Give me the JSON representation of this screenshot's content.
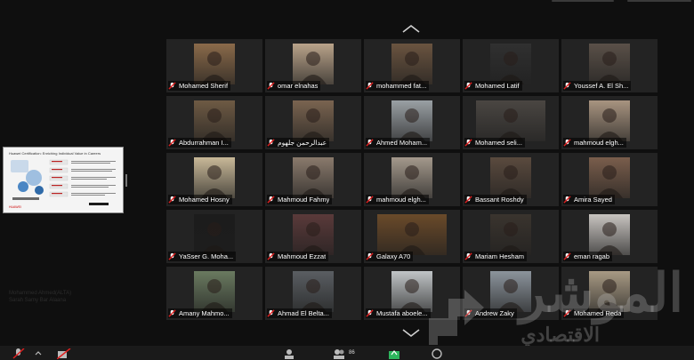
{
  "participants": [
    {
      "name": "Mohamed Sherif",
      "color": "#8a6a4a",
      "wide": false
    },
    {
      "name": "omar elnahas",
      "color": "#b9a38a",
      "wide": false
    },
    {
      "name": "mohammed fat...",
      "color": "#6a5440",
      "wide": false
    },
    {
      "name": "Mohamed Latif",
      "color": "#303030",
      "wide": false
    },
    {
      "name": "Youssef A. El Sh...",
      "color": "#5a5048",
      "wide": false
    },
    {
      "name": "Abdurrahman I...",
      "color": "#6e5a44",
      "wide": false
    },
    {
      "name": "عبدالرحمن جلهوم",
      "color": "#7a6450",
      "wide": false
    },
    {
      "name": "Ahmed Moham...",
      "color": "#9aa0a4",
      "wide": false
    },
    {
      "name": "Mohamed seli...",
      "color": "#4a4642",
      "wide": true
    },
    {
      "name": "mahmoud elgh...",
      "color": "#a89480",
      "wide": false
    },
    {
      "name": "Mohamed Hosny",
      "color": "#c8b898",
      "wide": false
    },
    {
      "name": "Mahmoud Fahmy",
      "color": "#8a7a6c",
      "wide": false
    },
    {
      "name": "mahmoud elgh...",
      "color": "#a4998c",
      "wide": false
    },
    {
      "name": "Bassant Roshdy",
      "color": "#5a4a3e",
      "wide": false
    },
    {
      "name": "Amira Sayed",
      "color": "#7a5e4c",
      "wide": false
    },
    {
      "name": "YaSser G. Moha...",
      "color": "#1c1c1c",
      "wide": false
    },
    {
      "name": "Mahmoud Ezzat",
      "color": "#5a3a3a",
      "wide": false
    },
    {
      "name": "Galaxy A70",
      "color": "#6a4a2a",
      "wide": true
    },
    {
      "name": "Mariam Hesham",
      "color": "#3a342e",
      "wide": false
    },
    {
      "name": "eman ragab",
      "color": "#c8c4c0",
      "wide": false
    },
    {
      "name": "Amany Mahmo...",
      "color": "#6a7a60",
      "wide": false
    },
    {
      "name": "Ahmad El Belta...",
      "color": "#5a5e62",
      "wide": false
    },
    {
      "name": "Mustafa aboele...",
      "color": "#c0c4c6",
      "wide": false
    },
    {
      "name": "Andrew Zaky",
      "color": "#8c949c",
      "wide": false
    },
    {
      "name": "Mohamed Reda",
      "color": "#a89a84",
      "wide": false
    }
  ],
  "shared_screen": {
    "title": "Huawei Certification: Enriching Individual Value in Careers",
    "brand": "HUAWEI"
  },
  "faded_caption": {
    "line1": "Mohammed Ahmed(ALTA)",
    "line2": "Sarah Samy Bar Alaana"
  },
  "toolbar": {
    "participants_count": "86"
  },
  "watermark": {
    "main": "الموشر",
    "sub": "الاقتصادي"
  },
  "colors": {
    "muted_mic": "#e02020",
    "tile_bg": "#232323",
    "background": "#0f0f0f"
  }
}
